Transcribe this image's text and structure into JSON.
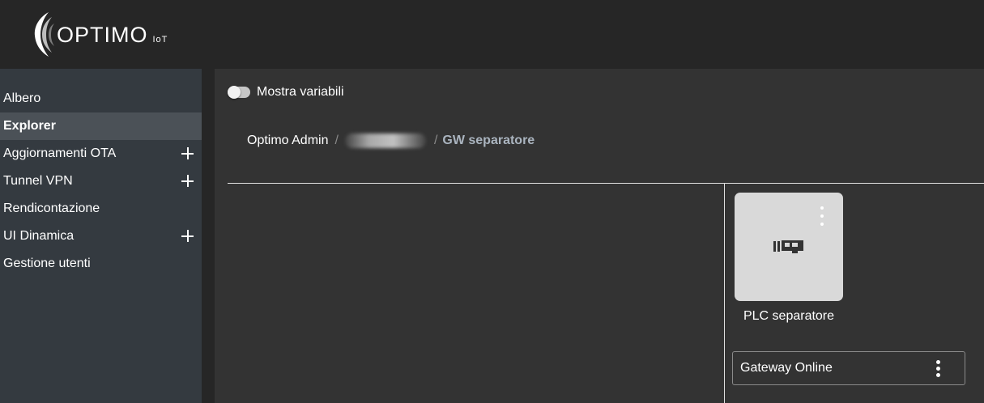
{
  "brand": {
    "name": "OPTIMO",
    "sub": "IoT"
  },
  "sidebar": {
    "items": [
      {
        "label": "Albero",
        "expandable": false,
        "active": false
      },
      {
        "label": "Explorer",
        "expandable": false,
        "active": true
      },
      {
        "label": "Aggiornamenti OTA",
        "expandable": true,
        "active": false
      },
      {
        "label": "Tunnel VPN",
        "expandable": true,
        "active": false
      },
      {
        "label": "Rendicontazione",
        "expandable": false,
        "active": false
      },
      {
        "label": "UI Dinamica",
        "expandable": true,
        "active": false
      },
      {
        "label": "Gestione utenti",
        "expandable": false,
        "active": false
      }
    ]
  },
  "toggle": {
    "label": "Mostra variabili",
    "on": false
  },
  "breadcrumb": {
    "root": "Optimo Admin",
    "separator": "/",
    "current": "GW separatore"
  },
  "device_tile": {
    "icon": "plc-card-icon",
    "label": "PLC separatore"
  },
  "status": {
    "label": "Gateway Online"
  },
  "colors": {
    "header_bg": "#262626",
    "sidebar_bg": "#343a40",
    "sidebar_active_bg": "#4b5157",
    "main_bg": "#333333",
    "tile_bg": "#d9d9d9",
    "breadcrumb_current": "#aab4bf"
  }
}
